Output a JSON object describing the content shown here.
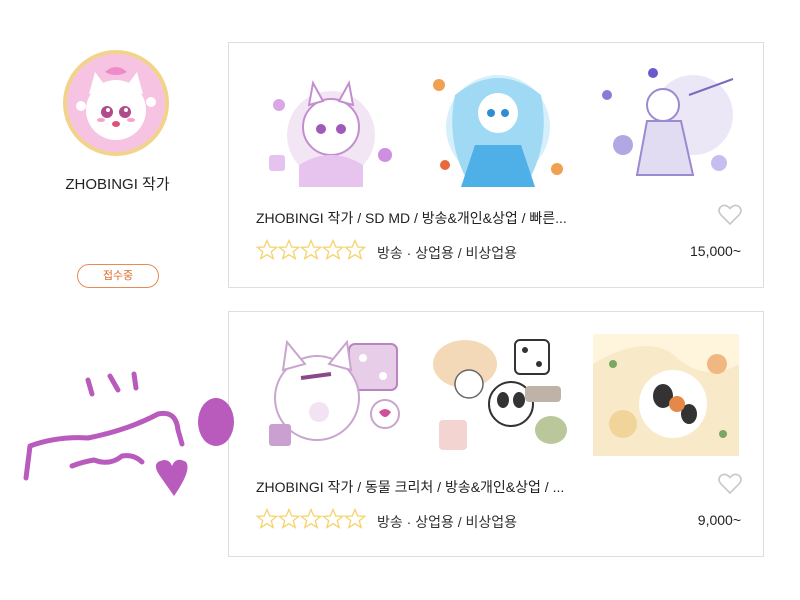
{
  "artist": {
    "name": "ZHOBINGI 작가",
    "status": "접수중"
  },
  "cards": [
    {
      "title": "ZHOBINGI 작가  /  SD MD / 방송&개인&상업 / 빠른...",
      "usage": "방송 · 상업용 / 비상업용",
      "price": "15,000~",
      "rating": 0
    },
    {
      "title": "ZHOBINGI 작가  /  동물 크리처 / 방송&개인&상업 / ...",
      "usage": "방송 · 상업용 / 비상업용",
      "price": "9,000~",
      "rating": 0
    }
  ],
  "colors": {
    "badge": "#e06a2a",
    "star": "#f5d36b",
    "doodle": "#b85bbd",
    "border": "#dedede"
  }
}
